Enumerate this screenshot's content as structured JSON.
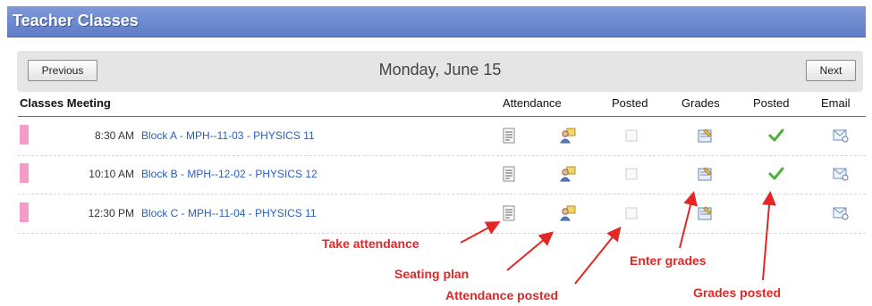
{
  "title": "Teacher Classes",
  "nav": {
    "prev_label": "Previous",
    "date": "Monday, June 15",
    "next_label": "Next"
  },
  "columns": {
    "classes": "Classes Meeting",
    "attendance": "Attendance",
    "posted_att": "Posted",
    "grades": "Grades",
    "posted_grades": "Posted",
    "email": "Email"
  },
  "rows": [
    {
      "time": "8:30 AM",
      "course": "Block A - MPH--11-03 - PHYSICS 11",
      "grades_posted": true
    },
    {
      "time": "10:10 AM",
      "course": "Block B - MPH--12-02 - PHYSICS 12",
      "grades_posted": true
    },
    {
      "time": "12:30 PM",
      "course": "Block C - MPH--11-04 - PHYSICS 11",
      "grades_posted": false
    }
  ],
  "annotations": {
    "take_attendance": "Take attendance",
    "seating_plan": "Seating plan",
    "attendance_posted": "Attendance posted",
    "enter_grades": "Enter grades",
    "grades_posted": "Grades posted"
  },
  "colors": {
    "title_bar": "#6f8bd0",
    "class_marker": "#f29cc6",
    "link": "#2a5dbf",
    "annotation": "#e32626"
  }
}
